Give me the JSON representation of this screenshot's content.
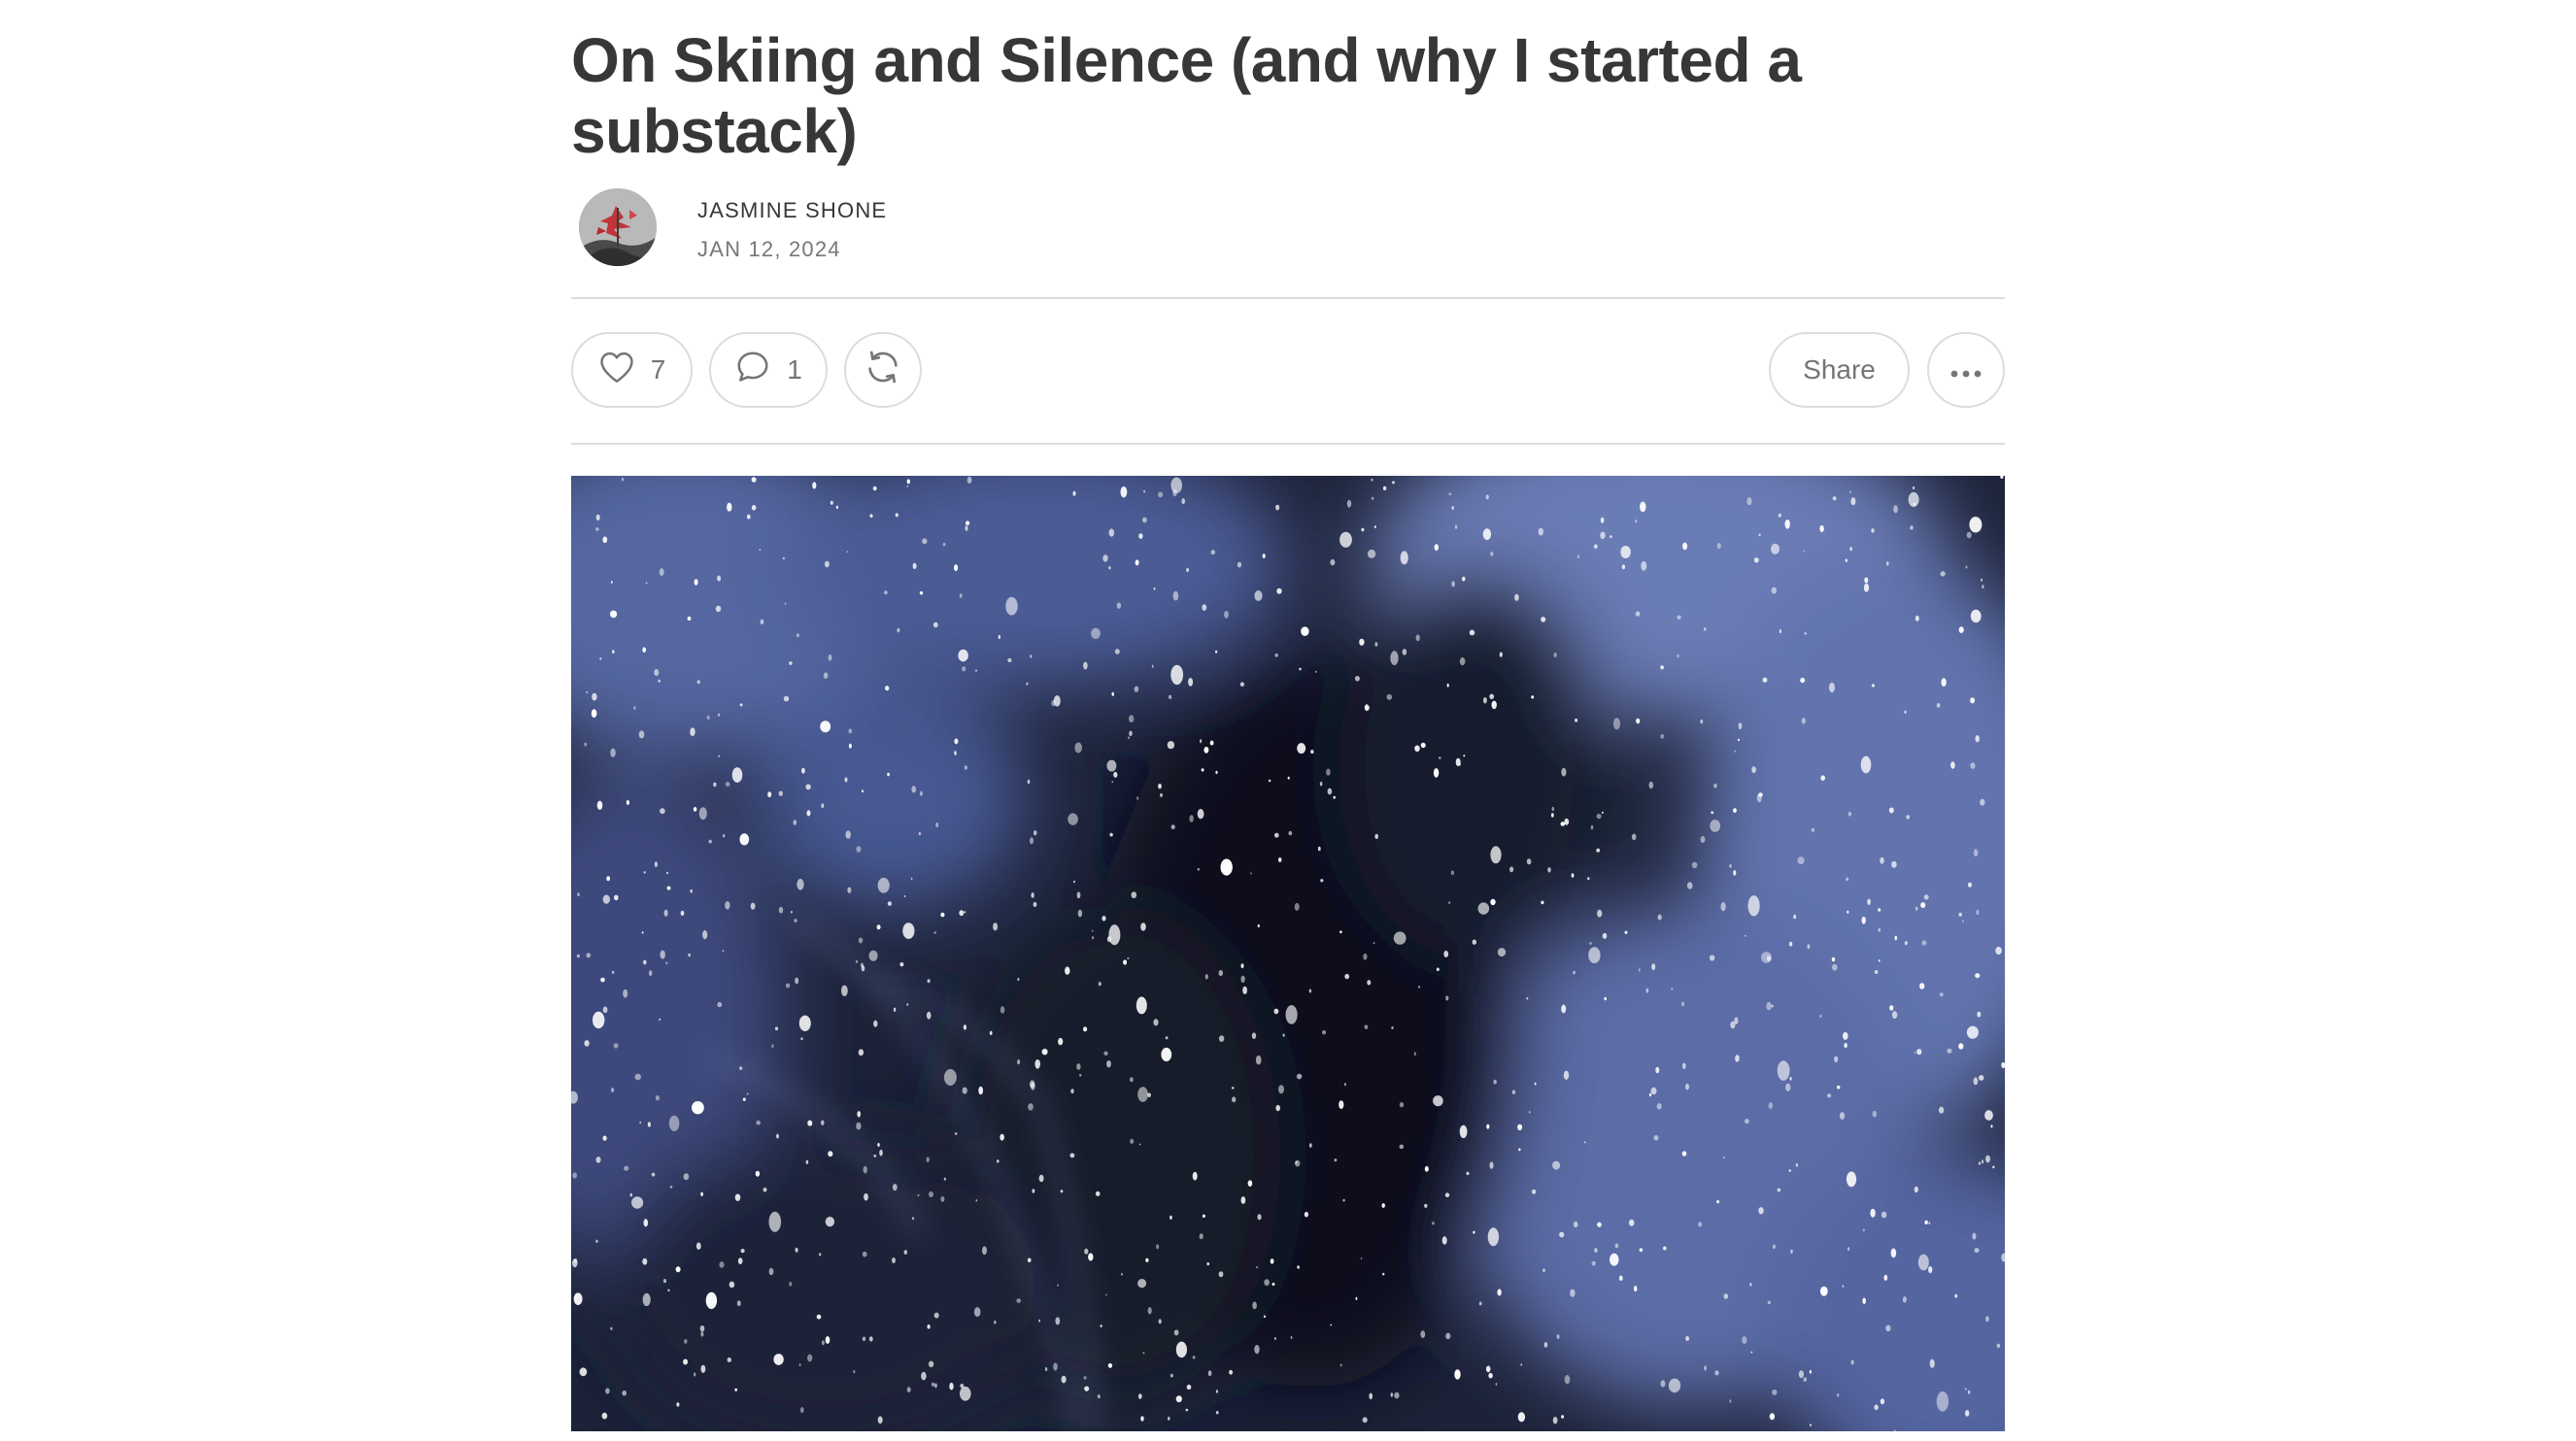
{
  "post": {
    "title": "On Skiing and Silence (and why I started a substack)",
    "author": "JASMINE SHONE",
    "date": "JAN 12, 2024"
  },
  "actions": {
    "likes": "7",
    "comments": "1",
    "share_label": "Share"
  },
  "icons": {
    "like": "heart-icon",
    "comment": "speech-bubble-icon",
    "restack": "restack-arrows-icon",
    "more": "ellipsis-icon"
  },
  "colors": {
    "text": "#363737",
    "muted": "#777777",
    "border": "#dcdcdc",
    "hero_base": "#1b2237"
  }
}
